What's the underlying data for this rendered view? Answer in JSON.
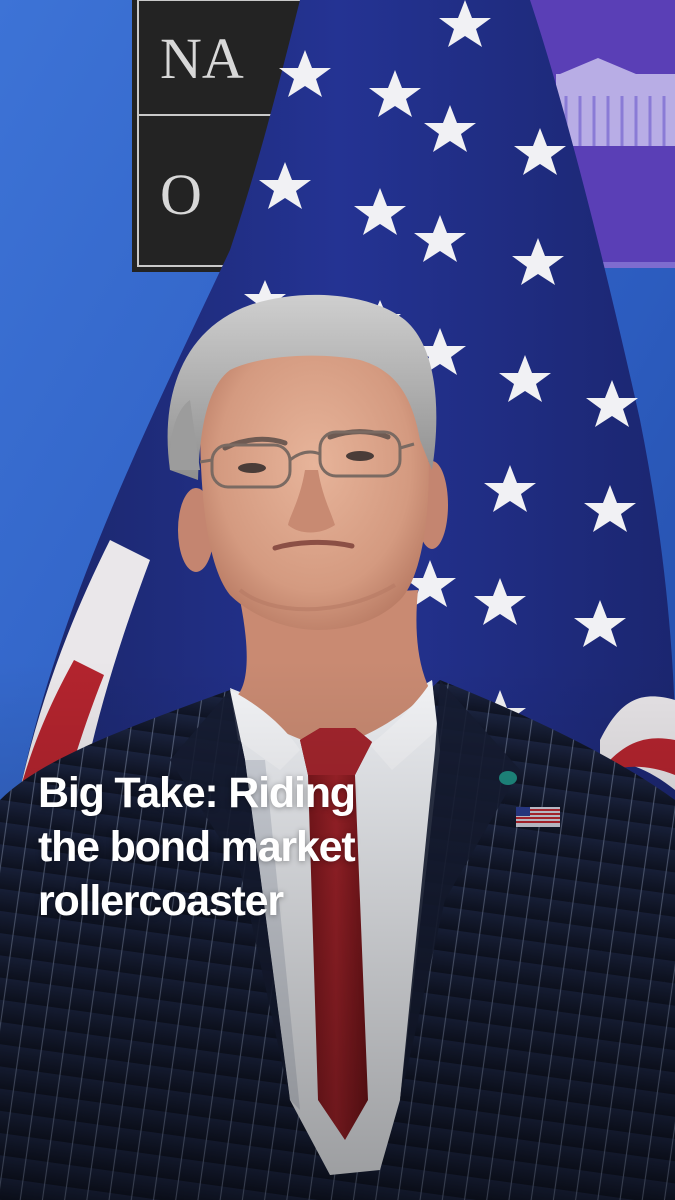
{
  "headline": {
    "lines": [
      "Big Take: Riding",
      "the bond market",
      "rollercoaster"
    ]
  },
  "backdrop_sign": {
    "letters_row1": "NA",
    "letters_row2": "O"
  },
  "colors": {
    "backdrop_blue": "#2f62c4",
    "flag_blue": "#1f2f7e",
    "flag_red": "#b3242e",
    "suit_navy": "#141b2f",
    "tie_red": "#8e1c22",
    "shirt_white": "#e9ebef",
    "headline_text": "#ffffff"
  }
}
